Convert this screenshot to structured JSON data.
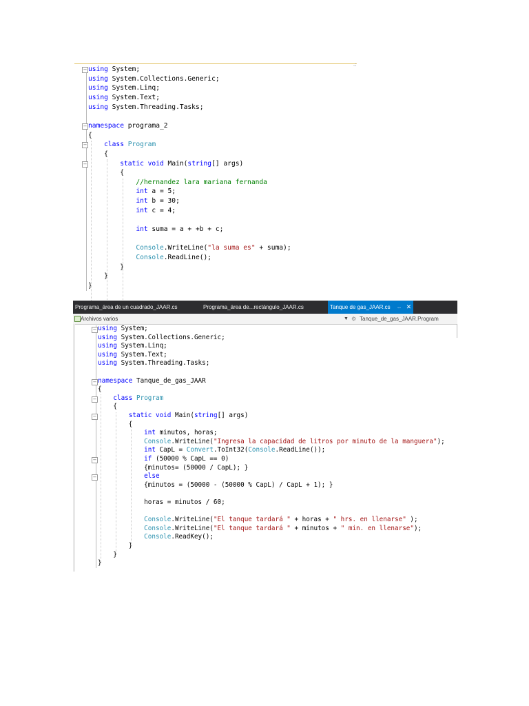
{
  "editor1": {
    "corner_mark": ".:",
    "lines": [
      [
        {
          "t": "using",
          "c": "kw"
        },
        {
          "t": " System;",
          "c": "pl"
        }
      ],
      [
        {
          "t": "using",
          "c": "kw"
        },
        {
          "t": " System.Collections.Generic;",
          "c": "pl"
        }
      ],
      [
        {
          "t": "using",
          "c": "kw"
        },
        {
          "t": " System.Linq;",
          "c": "pl"
        }
      ],
      [
        {
          "t": "using",
          "c": "kw"
        },
        {
          "t": " System.Text;",
          "c": "pl"
        }
      ],
      [
        {
          "t": "using",
          "c": "kw"
        },
        {
          "t": " System.Threading.Tasks;",
          "c": "pl"
        }
      ],
      [],
      [
        {
          "t": "namespace",
          "c": "kw"
        },
        {
          "t": " programa_2",
          "c": "pl"
        }
      ],
      [
        {
          "t": "{",
          "c": "pl"
        }
      ],
      [
        {
          "t": "    ",
          "c": "pl"
        },
        {
          "t": "class",
          "c": "kw"
        },
        {
          "t": " ",
          "c": "pl"
        },
        {
          "t": "Program",
          "c": "ty"
        }
      ],
      [
        {
          "t": "    {",
          "c": "pl"
        }
      ],
      [
        {
          "t": "        ",
          "c": "pl"
        },
        {
          "t": "static",
          "c": "kw"
        },
        {
          "t": " ",
          "c": "pl"
        },
        {
          "t": "void",
          "c": "kw"
        },
        {
          "t": " Main(",
          "c": "pl"
        },
        {
          "t": "string",
          "c": "kw"
        },
        {
          "t": "[] args)",
          "c": "pl"
        }
      ],
      [
        {
          "t": "        {",
          "c": "pl"
        }
      ],
      [
        {
          "t": "            ",
          "c": "pl"
        },
        {
          "t": "//hernandez lara mariana fernanda",
          "c": "cm"
        }
      ],
      [
        {
          "t": "            ",
          "c": "pl"
        },
        {
          "t": "int",
          "c": "kw"
        },
        {
          "t": " a = 5;",
          "c": "pl"
        }
      ],
      [
        {
          "t": "            ",
          "c": "pl"
        },
        {
          "t": "int",
          "c": "kw"
        },
        {
          "t": " b = 30;",
          "c": "pl"
        }
      ],
      [
        {
          "t": "            ",
          "c": "pl"
        },
        {
          "t": "int",
          "c": "kw"
        },
        {
          "t": " c = 4;",
          "c": "pl"
        }
      ],
      [],
      [
        {
          "t": "            ",
          "c": "pl"
        },
        {
          "t": "int",
          "c": "kw"
        },
        {
          "t": " suma = a + +b + c;",
          "c": "pl"
        }
      ],
      [],
      [
        {
          "t": "            ",
          "c": "pl"
        },
        {
          "t": "Console",
          "c": "ty"
        },
        {
          "t": ".WriteLine(",
          "c": "pl"
        },
        {
          "t": "\"la suma es\"",
          "c": "str"
        },
        {
          "t": " + suma);",
          "c": "pl"
        }
      ],
      [
        {
          "t": "            ",
          "c": "pl"
        },
        {
          "t": "Console",
          "c": "ty"
        },
        {
          "t": ".ReadLine();",
          "c": "pl"
        }
      ],
      [
        {
          "t": "        }",
          "c": "pl"
        }
      ],
      [
        {
          "t": "    }",
          "c": "pl"
        }
      ],
      [
        {
          "t": "}",
          "c": "pl"
        }
      ]
    ]
  },
  "editor2": {
    "tabs": [
      {
        "label": "Programa_área de un cuadrado_JAAR.cs"
      },
      {
        "label": "Programa_área de...rectángulo_JAAR.cs"
      },
      {
        "label": "Tanque de gas_JAAR.cs",
        "pin": "⇔",
        "close": "✕"
      }
    ],
    "nav": {
      "project": "Archivos varios",
      "class_path": "Tanque_de_gas_JAAR.Program"
    },
    "lines": [
      [
        {
          "t": "using",
          "c": "kw"
        },
        {
          "t": " System;",
          "c": "pl"
        }
      ],
      [
        {
          "t": "using",
          "c": "kw"
        },
        {
          "t": " System.Collections.Generic;",
          "c": "pl"
        }
      ],
      [
        {
          "t": "using",
          "c": "kw"
        },
        {
          "t": " System.Linq;",
          "c": "pl"
        }
      ],
      [
        {
          "t": "using",
          "c": "kw"
        },
        {
          "t": " System.Text;",
          "c": "pl"
        }
      ],
      [
        {
          "t": "using",
          "c": "kw"
        },
        {
          "t": " System.Threading.Tasks;",
          "c": "pl"
        }
      ],
      [],
      [
        {
          "t": "namespace",
          "c": "kw"
        },
        {
          "t": " Tanque_de_gas_JAAR",
          "c": "pl"
        }
      ],
      [
        {
          "t": "{",
          "c": "pl"
        }
      ],
      [
        {
          "t": "    ",
          "c": "pl"
        },
        {
          "t": "class",
          "c": "kw"
        },
        {
          "t": " ",
          "c": "pl"
        },
        {
          "t": "Program",
          "c": "ty"
        }
      ],
      [
        {
          "t": "    {",
          "c": "pl"
        }
      ],
      [
        {
          "t": "        ",
          "c": "pl"
        },
        {
          "t": "static",
          "c": "kw"
        },
        {
          "t": " ",
          "c": "pl"
        },
        {
          "t": "void",
          "c": "kw"
        },
        {
          "t": " Main(",
          "c": "pl"
        },
        {
          "t": "string",
          "c": "kw"
        },
        {
          "t": "[] args)",
          "c": "pl"
        }
      ],
      [
        {
          "t": "        {",
          "c": "pl"
        }
      ],
      [
        {
          "t": "            ",
          "c": "pl"
        },
        {
          "t": "int",
          "c": "kw"
        },
        {
          "t": " minutos, horas;",
          "c": "pl"
        }
      ],
      [
        {
          "t": "            ",
          "c": "pl"
        },
        {
          "t": "Console",
          "c": "ty"
        },
        {
          "t": ".WriteLine(",
          "c": "pl"
        },
        {
          "t": "\"Ingresa la capacidad de litros por minuto de la manguera\"",
          "c": "str"
        },
        {
          "t": ");",
          "c": "pl"
        }
      ],
      [
        {
          "t": "            ",
          "c": "pl"
        },
        {
          "t": "int",
          "c": "kw"
        },
        {
          "t": " CapL = ",
          "c": "pl"
        },
        {
          "t": "Convert",
          "c": "ty"
        },
        {
          "t": ".ToInt32(",
          "c": "pl"
        },
        {
          "t": "Console",
          "c": "ty"
        },
        {
          "t": ".ReadLine());",
          "c": "pl"
        }
      ],
      [
        {
          "t": "            ",
          "c": "pl"
        },
        {
          "t": "if",
          "c": "kw"
        },
        {
          "t": " (50000 % CapL == 0)",
          "c": "pl"
        }
      ],
      [
        {
          "t": "            {minutos= (50000 / CapL); }",
          "c": "pl"
        }
      ],
      [
        {
          "t": "            ",
          "c": "pl"
        },
        {
          "t": "else",
          "c": "kw"
        }
      ],
      [
        {
          "t": "            {minutos = (50000 - (50000 % CapL) / CapL + 1); }",
          "c": "pl"
        }
      ],
      [],
      [
        {
          "t": "            horas = minutos / 60;",
          "c": "pl"
        }
      ],
      [],
      [
        {
          "t": "            ",
          "c": "pl"
        },
        {
          "t": "Console",
          "c": "ty"
        },
        {
          "t": ".WriteLine(",
          "c": "pl"
        },
        {
          "t": "\"El tanque tardará \"",
          "c": "str"
        },
        {
          "t": " + horas + ",
          "c": "pl"
        },
        {
          "t": "\" hrs. en llenarse\"",
          "c": "str"
        },
        {
          "t": " );",
          "c": "pl"
        }
      ],
      [
        {
          "t": "            ",
          "c": "pl"
        },
        {
          "t": "Console",
          "c": "ty"
        },
        {
          "t": ".WriteLine(",
          "c": "pl"
        },
        {
          "t": "\"El tanque tardará \"",
          "c": "str"
        },
        {
          "t": " + minutos + ",
          "c": "pl"
        },
        {
          "t": "\" min. en llenarse\"",
          "c": "str"
        },
        {
          "t": ");",
          "c": "pl"
        }
      ],
      [
        {
          "t": "            ",
          "c": "pl"
        },
        {
          "t": "Console",
          "c": "ty"
        },
        {
          "t": ".ReadKey();",
          "c": "pl"
        }
      ],
      [
        {
          "t": "        }",
          "c": "pl"
        }
      ],
      [
        {
          "t": "    }",
          "c": "pl"
        }
      ],
      [
        {
          "t": "}",
          "c": "pl"
        }
      ]
    ]
  }
}
